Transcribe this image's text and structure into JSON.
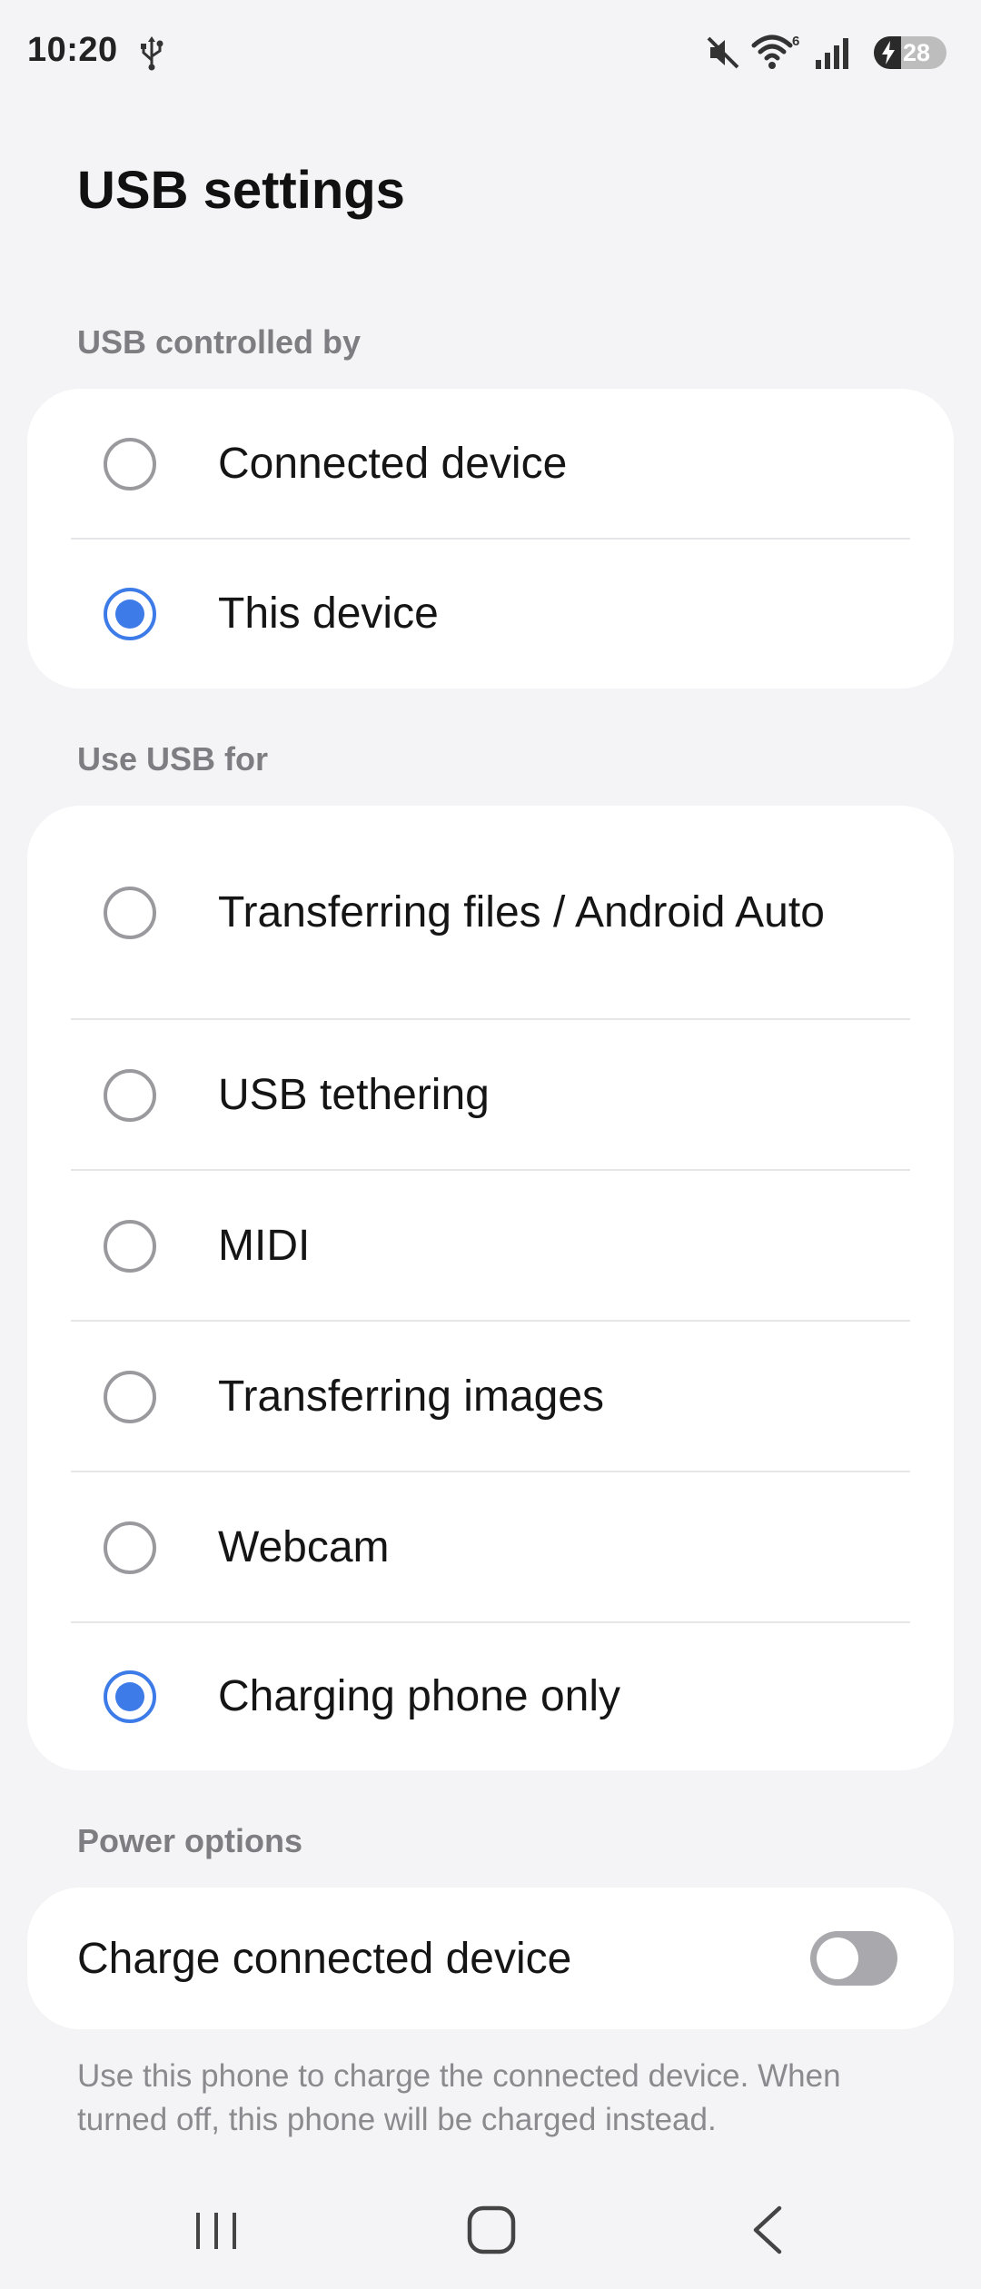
{
  "status_bar": {
    "time": "10:20",
    "battery_level": "28",
    "icons": [
      "usb-icon",
      "mute-icon",
      "wifi-icon",
      "signal-icon",
      "battery-charging-icon"
    ],
    "wifi_badge": "6"
  },
  "page": {
    "title": "USB settings"
  },
  "usb_controlled_by": {
    "label": "USB controlled by",
    "options": [
      {
        "label": "Connected device",
        "selected": false
      },
      {
        "label": "This device",
        "selected": true
      }
    ]
  },
  "use_usb_for": {
    "label": "Use USB for",
    "options": [
      {
        "label": "Transferring files / Android Auto",
        "selected": false
      },
      {
        "label": "USB tethering",
        "selected": false
      },
      {
        "label": "MIDI",
        "selected": false
      },
      {
        "label": "Transferring images",
        "selected": false
      },
      {
        "label": "Webcam",
        "selected": false
      },
      {
        "label": "Charging phone only",
        "selected": true
      }
    ]
  },
  "power_options": {
    "label": "Power options",
    "charge_connected_device": {
      "label": "Charge connected device",
      "enabled": false
    },
    "footnote": "Use this phone to charge the connected device. When turned off, this phone will be charged instead."
  },
  "colors": {
    "accent": "#3d7be8",
    "background": "#f4f4f6",
    "card": "#ffffff",
    "section_label": "#7d7d82",
    "toggle_off": "#a9a9ad"
  },
  "nav_bar": {
    "icons": [
      "recents-icon",
      "home-icon",
      "back-icon"
    ]
  }
}
